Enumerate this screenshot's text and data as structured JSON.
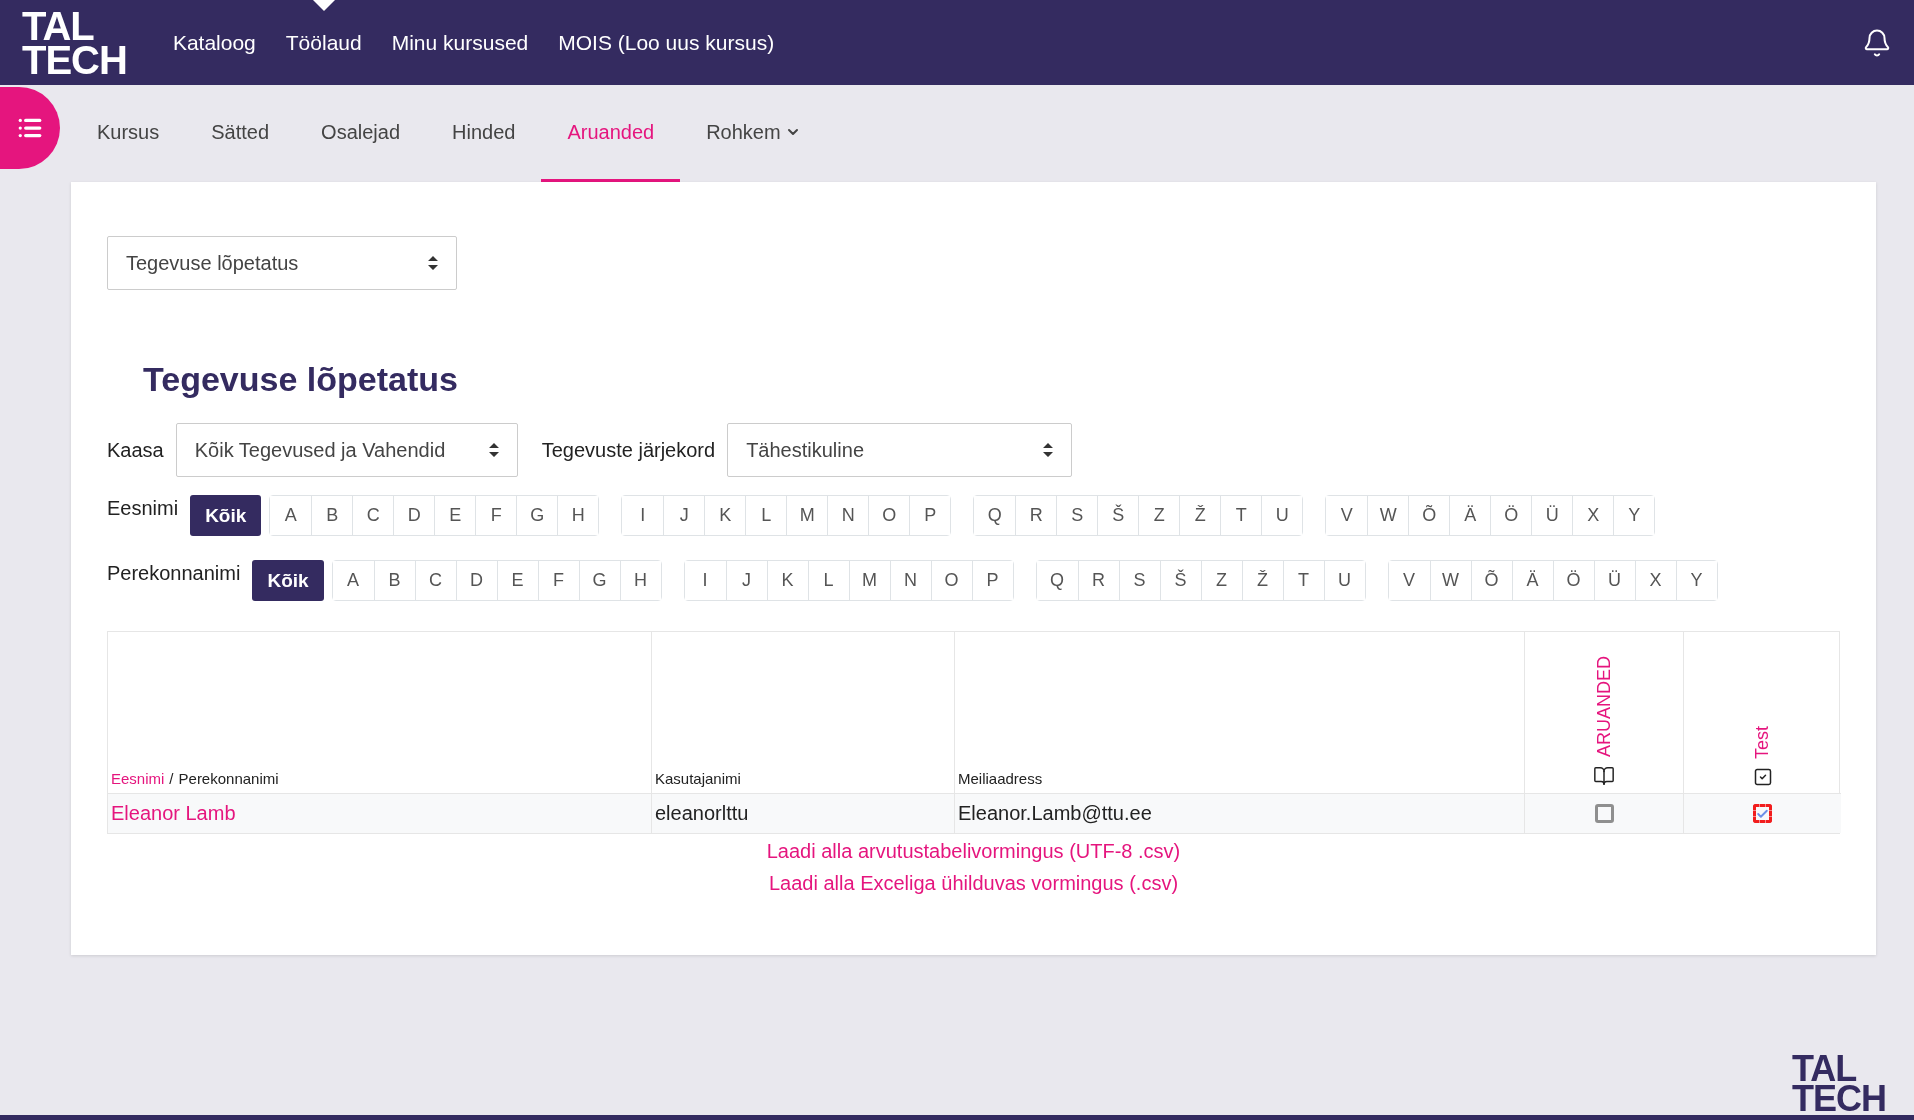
{
  "header": {
    "logo": [
      "TAL",
      "TECH"
    ],
    "nav": [
      {
        "label": "Kataloog",
        "selected": false
      },
      {
        "label": "Töölaud",
        "selected": true
      },
      {
        "label": "Minu kursused",
        "selected": false
      },
      {
        "label": "MOIS (Loo uus kursus)",
        "selected": false
      }
    ]
  },
  "tabs": [
    {
      "label": "Kursus",
      "selected": false,
      "dropdown": false
    },
    {
      "label": "Sätted",
      "selected": false,
      "dropdown": false
    },
    {
      "label": "Osalejad",
      "selected": false,
      "dropdown": false
    },
    {
      "label": "Hinded",
      "selected": false,
      "dropdown": false
    },
    {
      "label": "Aruanded",
      "selected": true,
      "dropdown": false
    },
    {
      "label": "Rohkem",
      "selected": false,
      "dropdown": true
    }
  ],
  "report_select": {
    "value": "Tegevuse lõpetatus"
  },
  "heading": "Tegevuse lõpetatus",
  "filters": [
    {
      "label": "Kaasa",
      "value": "Kõik Tegevused ja Vahendid"
    },
    {
      "label": "Tegevuste järjekord",
      "value": "Tähestikuline"
    }
  ],
  "initials": [
    {
      "label": "Eesnimi",
      "all": {
        "label": "Kõik",
        "selected": true
      },
      "groups": [
        [
          "A",
          "B",
          "C",
          "D",
          "E",
          "F",
          "G",
          "H"
        ],
        [
          "I",
          "J",
          "K",
          "L",
          "M",
          "N",
          "O",
          "P"
        ],
        [
          "Q",
          "R",
          "S",
          "Š",
          "Z",
          "Ž",
          "T",
          "U"
        ],
        [
          "V",
          "W",
          "Õ",
          "Ä",
          "Ö",
          "Ü",
          "X",
          "Y"
        ]
      ]
    },
    {
      "label": "Perekonnanimi",
      "all": {
        "label": "Kõik",
        "selected": true
      },
      "groups": [
        [
          "A",
          "B",
          "C",
          "D",
          "E",
          "F",
          "G",
          "H"
        ],
        [
          "I",
          "J",
          "K",
          "L",
          "M",
          "N",
          "O",
          "P"
        ],
        [
          "Q",
          "R",
          "S",
          "Š",
          "Z",
          "Ž",
          "T",
          "U"
        ],
        [
          "V",
          "W",
          "Õ",
          "Ä",
          "Ö",
          "Ü",
          "X",
          "Y"
        ]
      ]
    }
  ],
  "table": {
    "name_header": {
      "first": "Eesnimi",
      "separator": "/",
      "last": "Perekonnanimi"
    },
    "columns": [
      "Kasutajanimi",
      "Meiliaadress"
    ],
    "activities": [
      {
        "label": "ARUANDED",
        "kind": "book"
      },
      {
        "label": "Test",
        "kind": "check"
      }
    ],
    "rows": [
      {
        "name": "Eleanor Lamb",
        "username": "eleanorlttu",
        "email": "Eleanor.Lamb@ttu.ee",
        "completion": [
          {
            "checked": false,
            "overridden": false
          },
          {
            "checked": true,
            "overridden": true
          }
        ]
      }
    ]
  },
  "downloads": [
    "Laadi alla arvutustabelivormingus (UTF-8 .csv)",
    "Laadi alla Exceliga ühilduvas vormingus (.csv)"
  ],
  "footer": {
    "logo": [
      "TAL",
      "TECH"
    ]
  }
}
